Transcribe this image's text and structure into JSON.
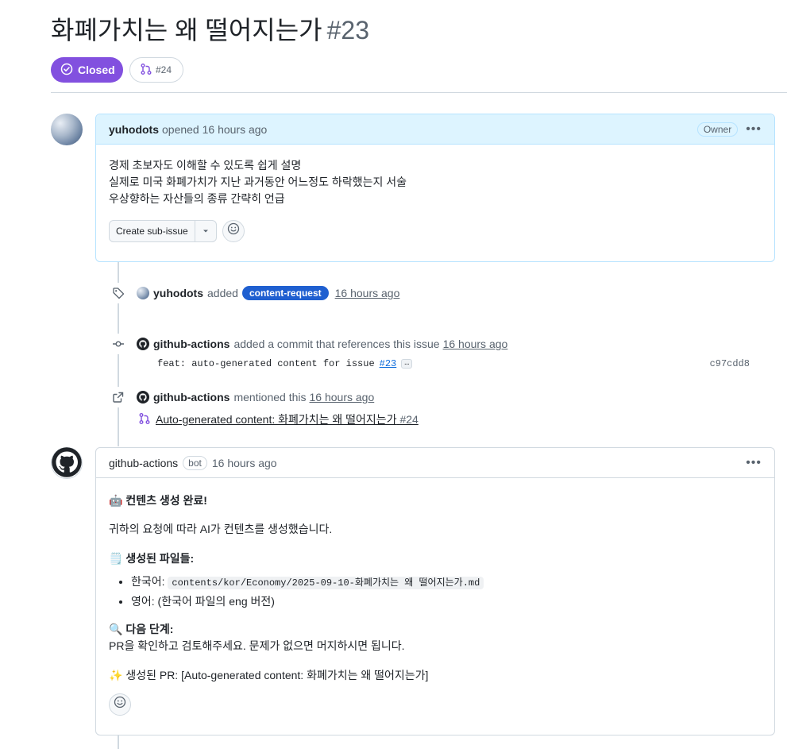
{
  "issue": {
    "title": "화폐가치는 왜 떨어지는가",
    "number": "#23",
    "state": "Closed",
    "linked_pr": "#24"
  },
  "colors": {
    "closed_purple": "#8250df",
    "label_blue": "#1f5fd0",
    "owner_header_bg": "#ddf4ff"
  },
  "first_comment": {
    "author": "yuhodots",
    "action": "opened",
    "time": "16 hours ago",
    "badge": "Owner",
    "lines": [
      "경제 초보자도 이해할 수 있도록 쉽게 설명",
      "실제로 미국 화폐가치가 지난 과거동안 어느정도 하락했는지 서술",
      "우상향하는 자산들의 종류 간략히 언급"
    ],
    "create_sub_issue_label": "Create sub-issue"
  },
  "events": {
    "label_event": {
      "author": "yuhodots",
      "action": "added",
      "label": "content-request",
      "time": "16 hours ago"
    },
    "commit_event": {
      "author": "github-actions",
      "action": "added a commit that references this issue",
      "time": "16 hours ago",
      "commit_message": "feat: auto-generated content for issue",
      "commit_ref": "#23",
      "more": "…",
      "sha": "c97cdd8"
    },
    "mention_event": {
      "author": "github-actions",
      "action": "mentioned this",
      "time": "16 hours ago",
      "pr_title": "Auto-generated content: 화폐가치는 왜 떨어지는가",
      "pr_number": "#24"
    }
  },
  "bot_comment": {
    "author": "github-actions",
    "badge": "bot",
    "time": "16 hours ago",
    "heading_emoji": "🤖",
    "heading": "컨텐츠 생성 완료!",
    "intro": "귀하의 요청에 따라 AI가 컨텐츠를 생성했습니다.",
    "files_emoji": "🗒️",
    "files_heading": "생성된 파일들:",
    "file_items": [
      {
        "label": "한국어:",
        "path": "contents/kor/Economy/2025-09-10-화폐가치는 왜 떨어지는가.md"
      },
      {
        "label": "영어:",
        "text": "(한국어 파일의 eng 버전)"
      }
    ],
    "next_emoji": "🔍",
    "next_heading": "다음 단계:",
    "next_text": "PR을 확인하고 검토해주세요. 문제가 없으면 머지하시면 됩니다.",
    "pr_emoji": "✨",
    "pr_text": "생성된 PR: [Auto-generated content: 화폐가치는 왜 떨어지는가]"
  }
}
